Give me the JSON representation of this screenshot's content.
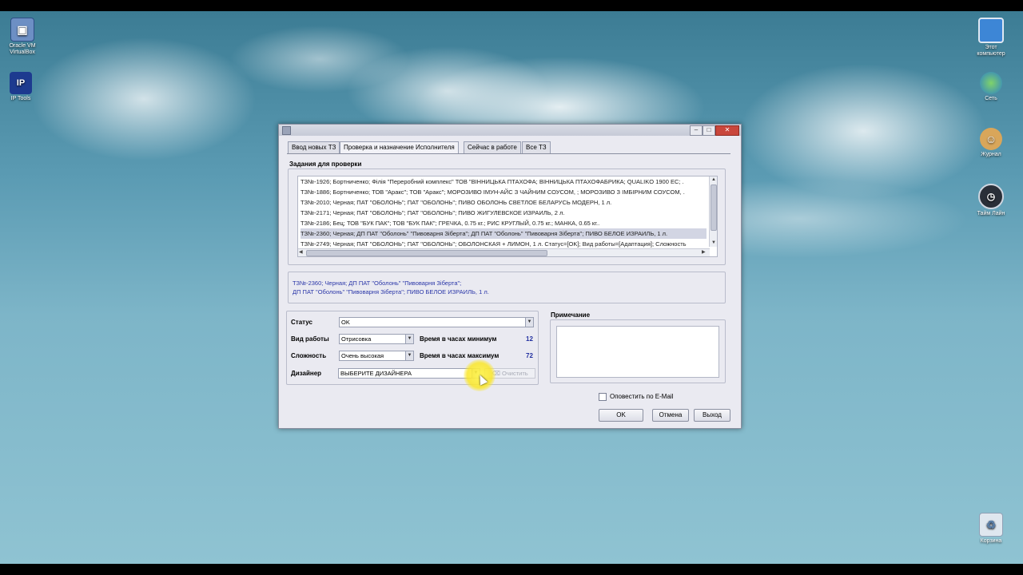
{
  "desktop_icons": [
    {
      "label": "Oracle VM\nVirtualBox",
      "icon": "virtualbox-icon"
    },
    {
      "label": "IP Tools",
      "icon": "iptools-icon",
      "glyph": "IP"
    },
    {
      "label": "Этот\nкомпьютер",
      "icon": "computer-icon"
    },
    {
      "label": "Сеть",
      "icon": "network-icon"
    },
    {
      "label": "Журнал",
      "icon": "journal-icon"
    },
    {
      "label": "Тайм Лайн",
      "icon": "timeline-icon"
    },
    {
      "label": "Корзина",
      "icon": "recycle-bin-icon"
    }
  ],
  "window": {
    "buttons": {
      "minimize": "–",
      "maximize": "□",
      "close": "✕"
    }
  },
  "tabs": [
    {
      "label": "Ввод новых ТЗ"
    },
    {
      "label": "Проверка и назначение Исполнителя",
      "active": true
    },
    {
      "label": "Сейчас в работе"
    },
    {
      "label": "Все ТЗ"
    }
  ],
  "tasks_group": {
    "title": "Задания для проверки",
    "rows": [
      "ТЗ№-1926; Бортниченко; Філія \"Переробний комплекс\" ТОВ \"ВІННИЦЬКА ПТАХОФА; ВІННИЦЬКА ПТАХОФАБРИКА; QUALIKO 1900 ЕС; .",
      "ТЗ№-1886; Бортниченко; ТОВ \"Аракс\"; ТОВ \"Аракс\"; МОРОЗИВО ІМУН-АЙС З ЧАЙНИМ СОУСОМ, ; МОРОЗИВО З ІМБІРНИМ СОУСОМ, .",
      "ТЗ№-2010; Черная; ПАТ \"ОБОЛОНЬ\"; ПАТ \"ОБОЛОНЬ\"; ПИВО ОБОЛОНЬ СВЕТЛОЕ БЕЛАРУСЬ МОДЕРН, 1 л.",
      "ТЗ№-2171; Черная; ПАТ \"ОБОЛОНЬ\"; ПАТ \"ОБОЛОНЬ\"; ПИВО ЖИГУЛЕВСКОЕ ИЗРАИЛЬ, 2 л.",
      "ТЗ№-2186; Бец; ТОВ \"БУК ПАК\"; ТОВ \"БУК ПАК\"; ГРЕЧКА, 0.75 кг.; РИС КРУГЛЫЙ, 0.75 кг.; МАНКА, 0.65 кг..",
      "ТЗ№-2360; Черная; ДП ПАТ \"Оболонь\" \"Пивоварня Зіберта\"; ДП ПАТ \"Оболонь\" \"Пивоварня Зіберта\"; ПИВО БЕЛОЕ ИЗРАИЛЬ, 1 л.",
      "ТЗ№-2749; Черная; ПАТ \"ОБОЛОНЬ\"; ПАТ \"ОБОЛОНЬ\"; ОБОЛОНСКАЯ + ЛИМОН, 1 л. Статус=[OK]; Вид работы=[Адаптация]; Сложность"
    ],
    "selected_index": 5
  },
  "detail": {
    "line1": "ТЗ№-2360; Черная; ДП ПАТ \"Оболонь\" \"Пивоварня Зіберта\";",
    "line2": "ДП ПАТ \"Оболонь\" \"Пивоварня Зіберта\"; ПИВО БЕЛОЕ ИЗРАИЛЬ, 1 л."
  },
  "form": {
    "status_label": "Статус",
    "status_value": "OK",
    "work_label": "Вид работы",
    "work_value": "Отрисовка",
    "complexity_label": "Сложность",
    "complexity_value": "Очень высокая",
    "designer_label": "Дизайнер",
    "designer_value": "ВЫБЕРИТЕ ДИЗАЙНЕРА",
    "min_time_label": "Время в часах минимум",
    "min_time_value": "12",
    "max_time_label": "Время в часах максимум",
    "max_time_value": "72",
    "clear_label": "Очистить"
  },
  "note": {
    "title": "Примечание"
  },
  "notify_label": "Оповестить по E-Mail",
  "actions": {
    "ok": "OK",
    "cancel": "Отмена",
    "exit": "Выход"
  }
}
